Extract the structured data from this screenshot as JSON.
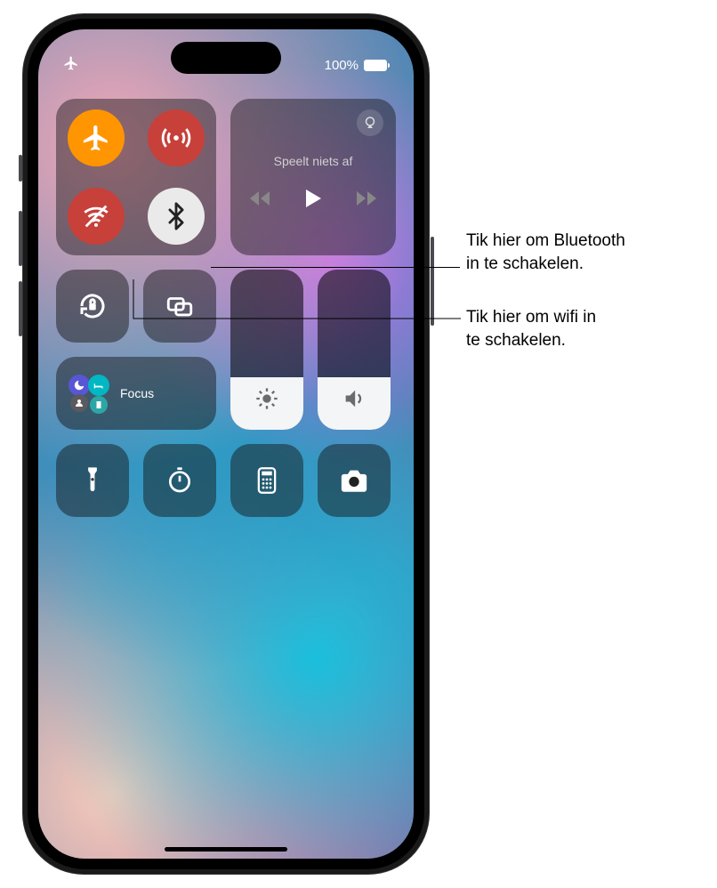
{
  "status": {
    "battery_pct": "100%"
  },
  "connectivity": {
    "airplane": {
      "name": "airplane-mode-button",
      "state": "on"
    },
    "cellular": {
      "name": "cellular-data-button",
      "state": "off-red"
    },
    "wifi": {
      "name": "wifi-button",
      "state": "off-red"
    },
    "bluetooth": {
      "name": "bluetooth-button",
      "state": "on-white"
    }
  },
  "media": {
    "now_playing_status": "Speelt niets af"
  },
  "focus": {
    "label": "Focus"
  },
  "sliders": {
    "brightness_pct": 33,
    "volume_pct": 33
  },
  "callouts": {
    "bluetooth_line1": "Tik hier om Bluetooth",
    "bluetooth_line2": "in te schakelen.",
    "wifi_line1": "Tik hier om wifi in",
    "wifi_line2": "te schakelen."
  }
}
